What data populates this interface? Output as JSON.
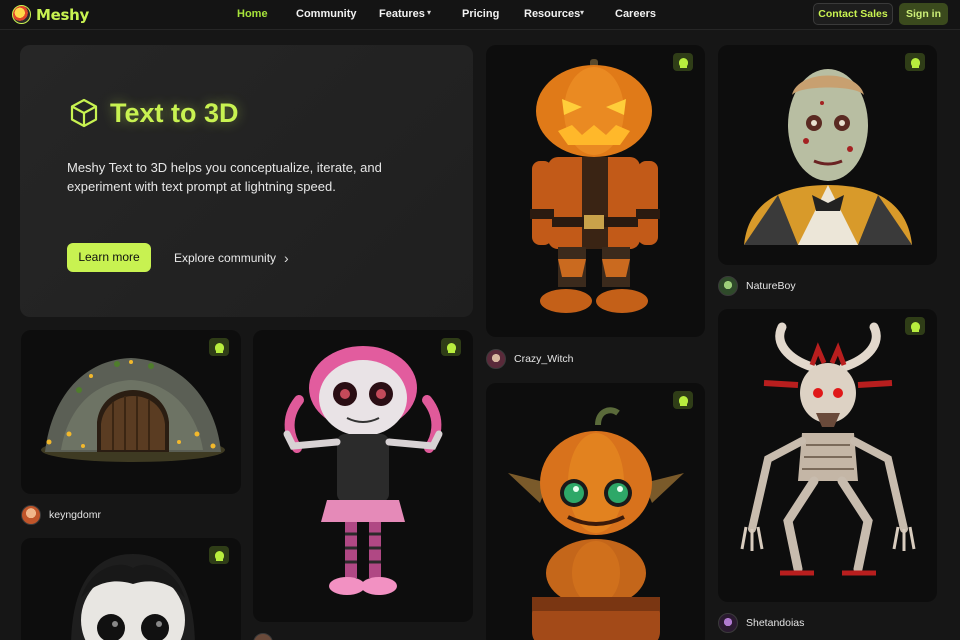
{
  "brand": {
    "name": "Meshy"
  },
  "nav": {
    "items": [
      {
        "label": "Home",
        "active": true
      },
      {
        "label": "Community"
      },
      {
        "label": "Features",
        "dropdown": true
      },
      {
        "label": "Pricing"
      },
      {
        "label": "Resources",
        "dropdown": true
      },
      {
        "label": "Careers"
      }
    ],
    "contact_label": "Contact Sales",
    "signin_label": "Sign in"
  },
  "hero": {
    "title": "Text to 3D",
    "description": "Meshy Text to 3D helps you conceptualize, iterate, and experiment with text prompt at lightning speed.",
    "learn_label": "Learn more",
    "explore_label": "Explore community"
  },
  "cards": [
    {
      "subject": "cave-entrance",
      "author": "keyngdomr"
    },
    {
      "subject": "zombie-doll-girl",
      "author": ""
    },
    {
      "subject": "vampire-face",
      "author": ""
    },
    {
      "subject": "pumpkin-head-pirate",
      "author": "Crazy_Witch"
    },
    {
      "subject": "pumpkin-goblin",
      "author": ""
    },
    {
      "subject": "zombie-old-man-bust",
      "author": "NatureBoy"
    },
    {
      "subject": "skeletal-demon",
      "author": "Shetandoias"
    }
  ],
  "colors": {
    "accent": "#c8f251",
    "background": "#161616",
    "card": "#0d0d0d"
  }
}
